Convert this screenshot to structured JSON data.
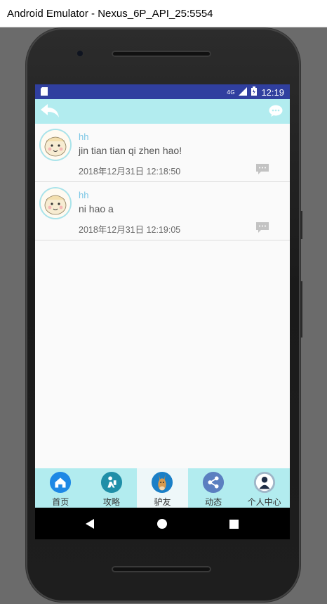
{
  "window": {
    "title": "Android Emulator - Nexus_6P_API_25:5554"
  },
  "status_bar": {
    "network": "4G",
    "time": "12:19"
  },
  "app_bar": {
    "back_icon": "reply-arrow-icon",
    "menu_icon": "chat-bubble-more-icon"
  },
  "posts": [
    {
      "username": "hh",
      "message": "jin tian tian qi zhen hao!",
      "timestamp": "2018年12月31日 12:18:50"
    },
    {
      "username": "hh",
      "message": "ni hao a",
      "timestamp": "2018年12月31日 12:19:05"
    }
  ],
  "tabs": [
    {
      "label": "首页",
      "icon": "home-icon"
    },
    {
      "label": "攻略",
      "icon": "guide-icon"
    },
    {
      "label": "驴友",
      "icon": "donkey-icon",
      "active": true
    },
    {
      "label": "动态",
      "icon": "share-icon"
    },
    {
      "label": "个人中心",
      "icon": "user-icon"
    }
  ],
  "colors": {
    "status_bar": "#303f9f",
    "app_bar": "#b2ecef",
    "username": "#7ec7e6"
  }
}
